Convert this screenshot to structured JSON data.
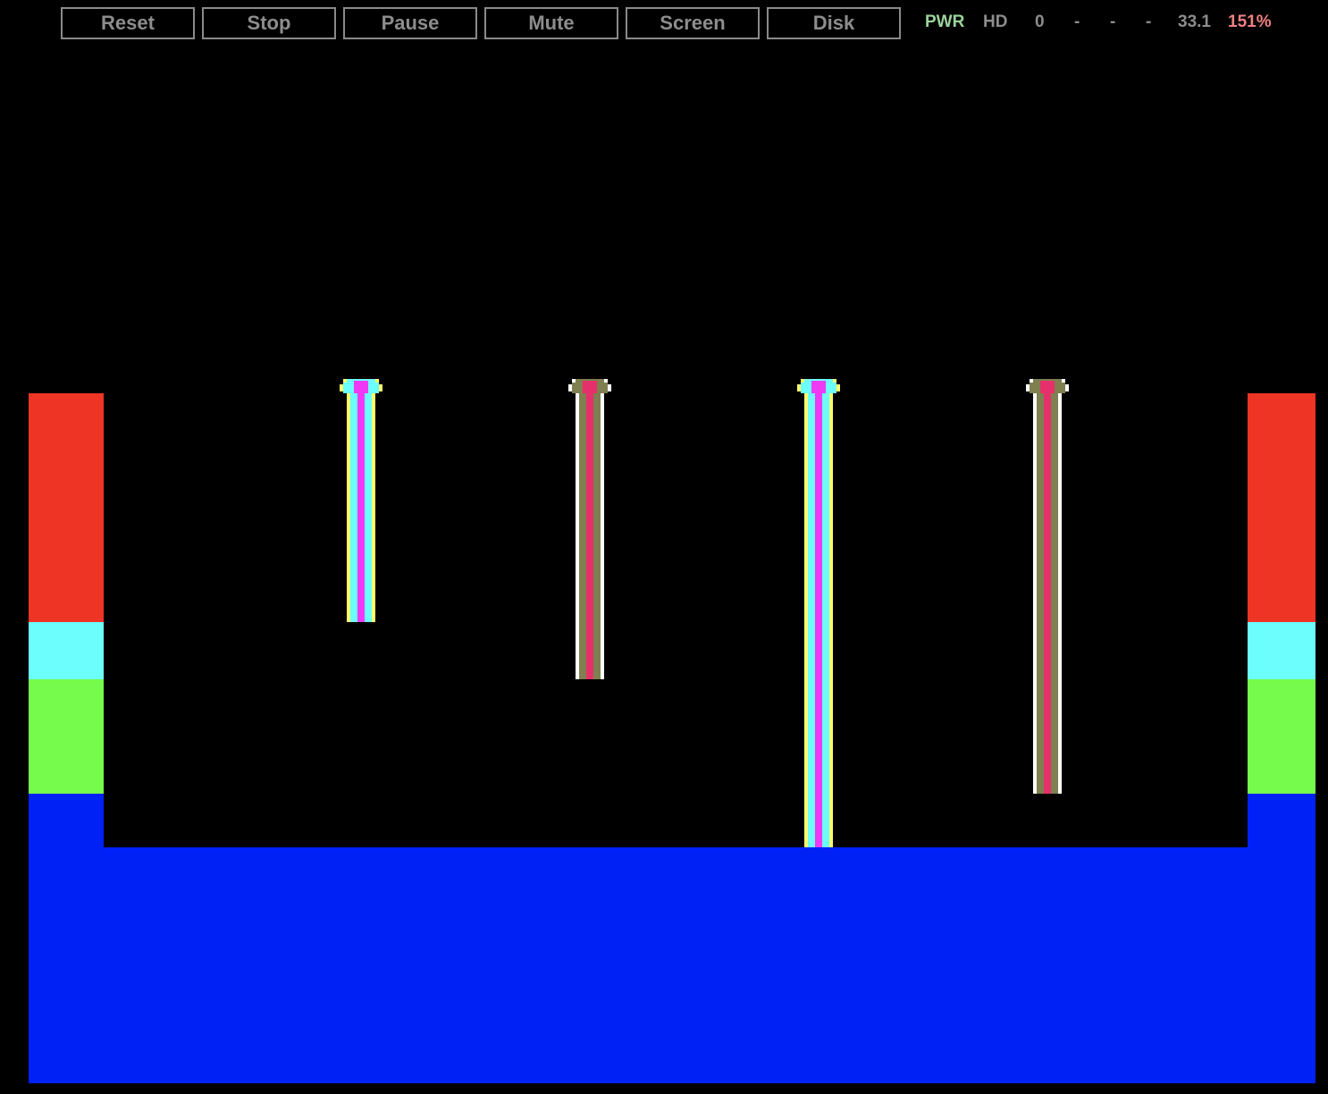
{
  "toolbar": {
    "buttons": [
      "Reset",
      "Stop",
      "Pause",
      "Mute",
      "Screen",
      "Disk"
    ]
  },
  "status": {
    "pwr": "PWR",
    "hd": "HD",
    "drive": "0",
    "dash1": "-",
    "dash2": "-",
    "dash3": "-",
    "speed": "33.1",
    "percent": "151%"
  },
  "colors": {
    "pwr": "#9bd39b",
    "percent": "#f08080",
    "status_gray": "#8d8d8d",
    "red": "#ee3424",
    "cyan": "#6cfdfd",
    "green": "#76fa4c",
    "blue": "#0021f5",
    "magenta": "#ef3af5",
    "yellow": "#fdfd6c",
    "pink": "#e6306b",
    "olive": "#7f7f50",
    "white": "#ffffff"
  },
  "game": {
    "pillars": [
      {
        "name": "pillar-1",
        "palette": "bright"
      },
      {
        "name": "pillar-2",
        "palette": "dim"
      },
      {
        "name": "pillar-3",
        "palette": "bright"
      },
      {
        "name": "pillar-4",
        "palette": "dim"
      }
    ]
  }
}
